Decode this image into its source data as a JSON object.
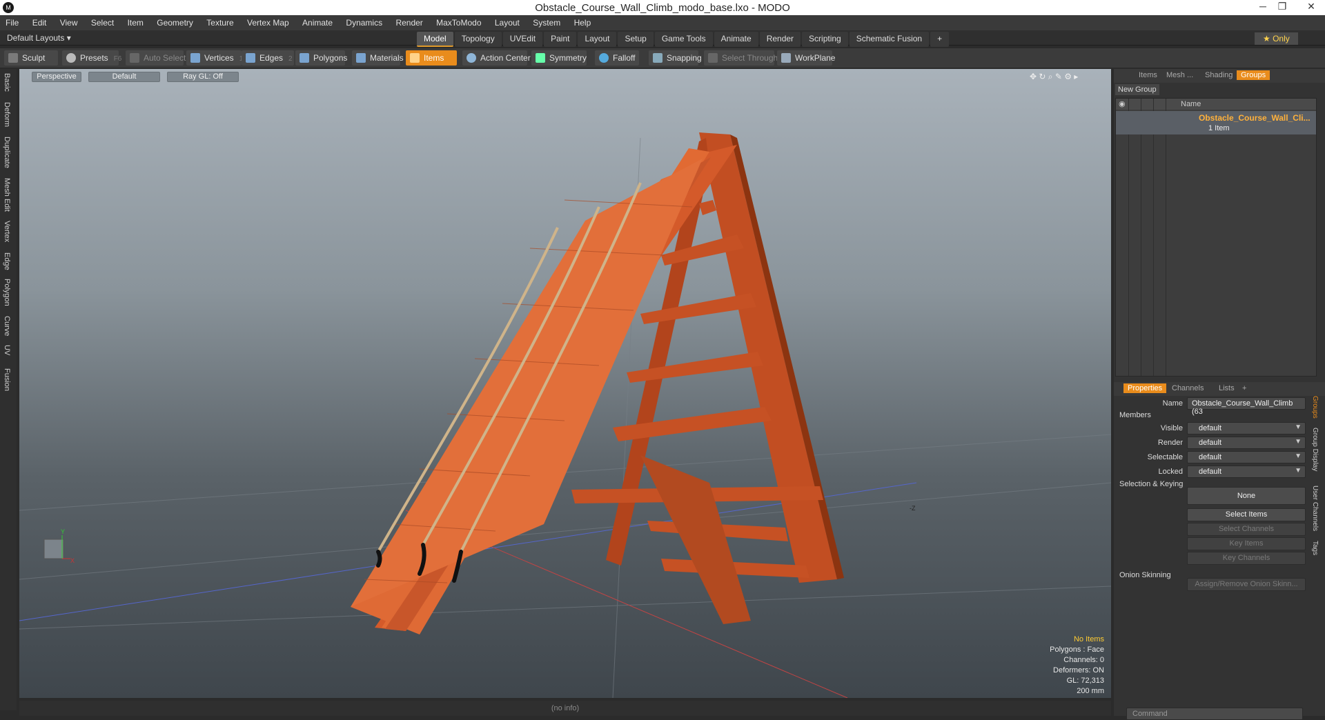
{
  "window": {
    "title": "Obstacle_Course_Wall_Climb_modo_base.lxo - MODO",
    "app_icon": "modo-icon",
    "controls": [
      "─",
      "❐",
      "✕"
    ]
  },
  "menu": [
    "File",
    "Edit",
    "View",
    "Select",
    "Item",
    "Geometry",
    "Texture",
    "Vertex Map",
    "Animate",
    "Dynamics",
    "Render",
    "MaxToModo",
    "Layout",
    "System",
    "Help"
  ],
  "layouts_label": "Default Layouts ▾",
  "tabs": [
    "Model",
    "Topology",
    "UVEdit",
    "Paint",
    "Layout",
    "Setup",
    "Game Tools",
    "Animate",
    "Render",
    "Scripting",
    "Schematic Fusion",
    "+"
  ],
  "only_label": "★ Only",
  "toolbar": {
    "sculpt": "Sculpt",
    "presets": "Presets",
    "presets_key": "F6",
    "auto_select": "Auto Select",
    "vertices": "Vertices",
    "vertices_key": "1",
    "edges": "Edges",
    "edges_key": "2",
    "polygons": "Polygons",
    "materials": "Materials",
    "items": "Items",
    "action_center": "Action Center",
    "symmetry": "Symmetry",
    "falloff": "Falloff",
    "snapping": "Snapping",
    "select_through": "Select Through",
    "workplane": "WorkPlane"
  },
  "left_tabs": [
    "Basic",
    "Deform",
    "Duplicate",
    "Mesh Edit",
    "Vertex",
    "Edge",
    "Polygon",
    "Curve",
    "UV",
    "Fusion"
  ],
  "viewport": {
    "perspective": "Perspective",
    "default": "Default",
    "raygl": "Ray GL: Off",
    "axis_label": "-Z",
    "stats": {
      "no_items": "No Items",
      "polygons": "Polygons : Face",
      "channels": "Channels: 0",
      "deformers": "Deformers: ON",
      "gl": "GL: 72,313",
      "scale": "200 mm"
    },
    "gizmo": {
      "x": "X",
      "y": "Y"
    }
  },
  "status": "(no info)",
  "right": {
    "tabs": [
      "Items",
      "Mesh ...",
      "Shading",
      "Groups"
    ],
    "new_group": "New Group",
    "list_header": "Name",
    "group_name": "Obstacle_Course_Wall_Cli...",
    "group_sub": "1 Item",
    "props_tabs": [
      "Properties",
      "Channels",
      "Lists",
      "+"
    ],
    "name_label": "Name",
    "name_value": "Obstacle_Course_Wall_Climb (63",
    "members": "Members",
    "visible_label": "Visible",
    "visible": "default",
    "render_label": "Render",
    "render": "default",
    "selectable_label": "Selectable",
    "selectable": "default",
    "locked_label": "Locked",
    "locked": "default",
    "selection_keying": "Selection & Keying",
    "none": "None",
    "select_items": "Select Items",
    "select_channels": "Select Channels",
    "key_items": "Key Items",
    "key_channels": "Key Channels",
    "onion": "Onion Skinning",
    "assign_onion": "Assign/Remove Onion Skinn...",
    "side_tabs": [
      "Groups",
      "Group Display",
      "User Channels",
      "Tags"
    ],
    "command_placeholder": "Command"
  }
}
